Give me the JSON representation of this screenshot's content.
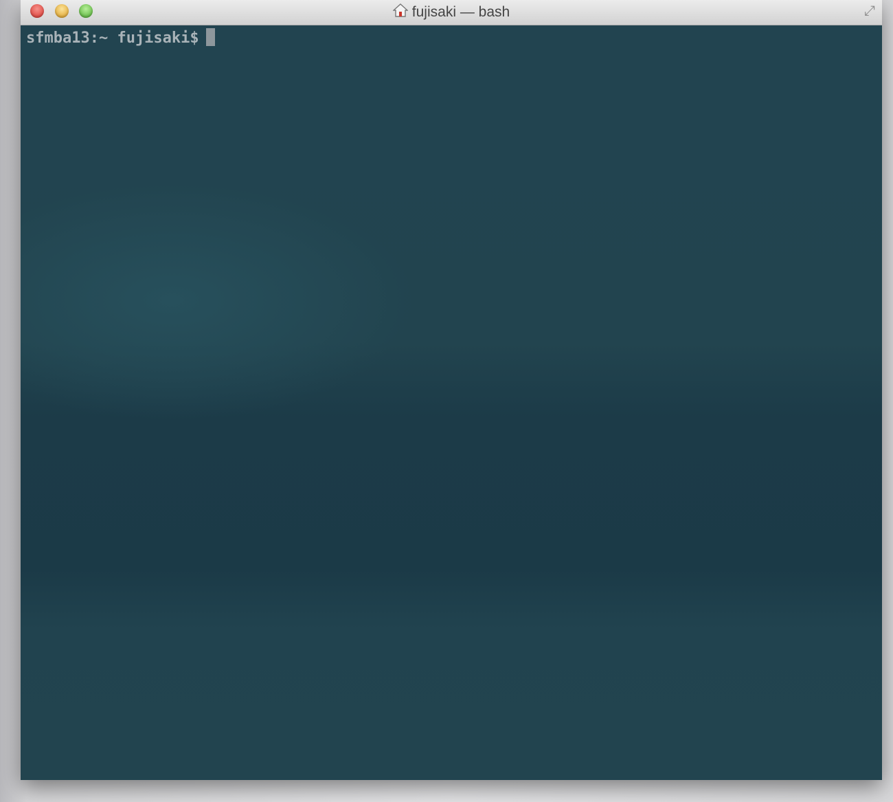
{
  "window": {
    "title": "fujisaki — bash",
    "title_icon": "home-icon",
    "buttons": [
      "close",
      "minimize",
      "zoom"
    ],
    "fullscreen_icon": "fullscreen-icon"
  },
  "terminal": {
    "prompt": "sfmba13:~ fujisaki$",
    "input": ""
  }
}
